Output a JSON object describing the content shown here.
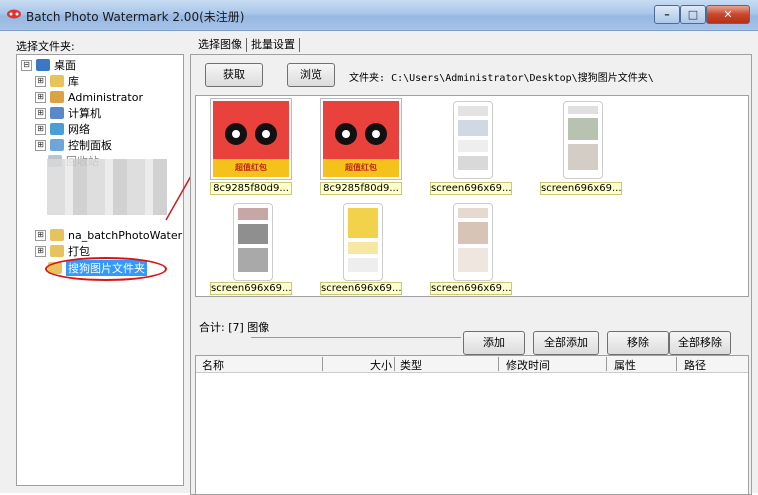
{
  "window": {
    "title": "Batch Photo Watermark 2.00(未注册)",
    "buttons": {
      "minimize": "–",
      "maximize": "□",
      "close": "✕"
    }
  },
  "left_panel": {
    "label": "选择文件夹:",
    "tree": [
      {
        "label": "桌面",
        "expander": "⊟",
        "icon": "desktop-icon"
      },
      {
        "label": "库",
        "expander": "⊞",
        "icon": "library-icon"
      },
      {
        "label": "Administrator",
        "expander": "⊞",
        "icon": "user-folder-icon"
      },
      {
        "label": "计算机",
        "expander": "⊞",
        "icon": "computer-icon"
      },
      {
        "label": "网络",
        "expander": "⊞",
        "icon": "network-icon"
      },
      {
        "label": "控制面板",
        "expander": "⊞",
        "icon": "control-panel-icon"
      },
      {
        "label": "回收站",
        "expander": "",
        "icon": "recycle-bin-icon"
      },
      {
        "label": "na_batchPhotoWaterMa",
        "expander": "⊞",
        "icon": "folder-icon"
      },
      {
        "label": "打包",
        "expander": "⊞",
        "icon": "folder-icon"
      },
      {
        "label": "搜狗图片文件夹",
        "expander": "",
        "icon": "folder-icon",
        "selected": true
      }
    ]
  },
  "tabs": [
    {
      "label": "选择图像",
      "active": true
    },
    {
      "label": "批量设置",
      "active": false
    }
  ],
  "toolbar": {
    "acquire_label": "获取",
    "browse_label": "浏览",
    "folder_label": "文件夹:",
    "folder_path": "C:\\Users\\Administrator\\Desktop\\搜狗图片文件夹\\"
  },
  "thumbnails": [
    {
      "label": "8c9285f80d9...",
      "kind": "bear",
      "banner": "超值红包"
    },
    {
      "label": "8c9285f80d9...",
      "kind": "bear",
      "banner": "超值红包"
    },
    {
      "label": "screen696x69...",
      "kind": "phone"
    },
    {
      "label": "screen696x69...",
      "kind": "phone"
    },
    {
      "label": "screen696x69...",
      "kind": "phone"
    },
    {
      "label": "screen696x69...",
      "kind": "phone"
    },
    {
      "label": "screen696x69...",
      "kind": "phone"
    }
  ],
  "summary": "合计: [7] 图像",
  "actions": {
    "add": "添加",
    "add_all": "全部添加",
    "remove": "移除",
    "remove_all": "全部移除"
  },
  "list_columns": [
    "名称",
    "大小",
    "类型",
    "修改时间",
    "属性",
    "路径"
  ],
  "colors": {
    "accent": "#3399ff",
    "annotation": "#dd1111",
    "label_highlight": "#ffffcc"
  }
}
